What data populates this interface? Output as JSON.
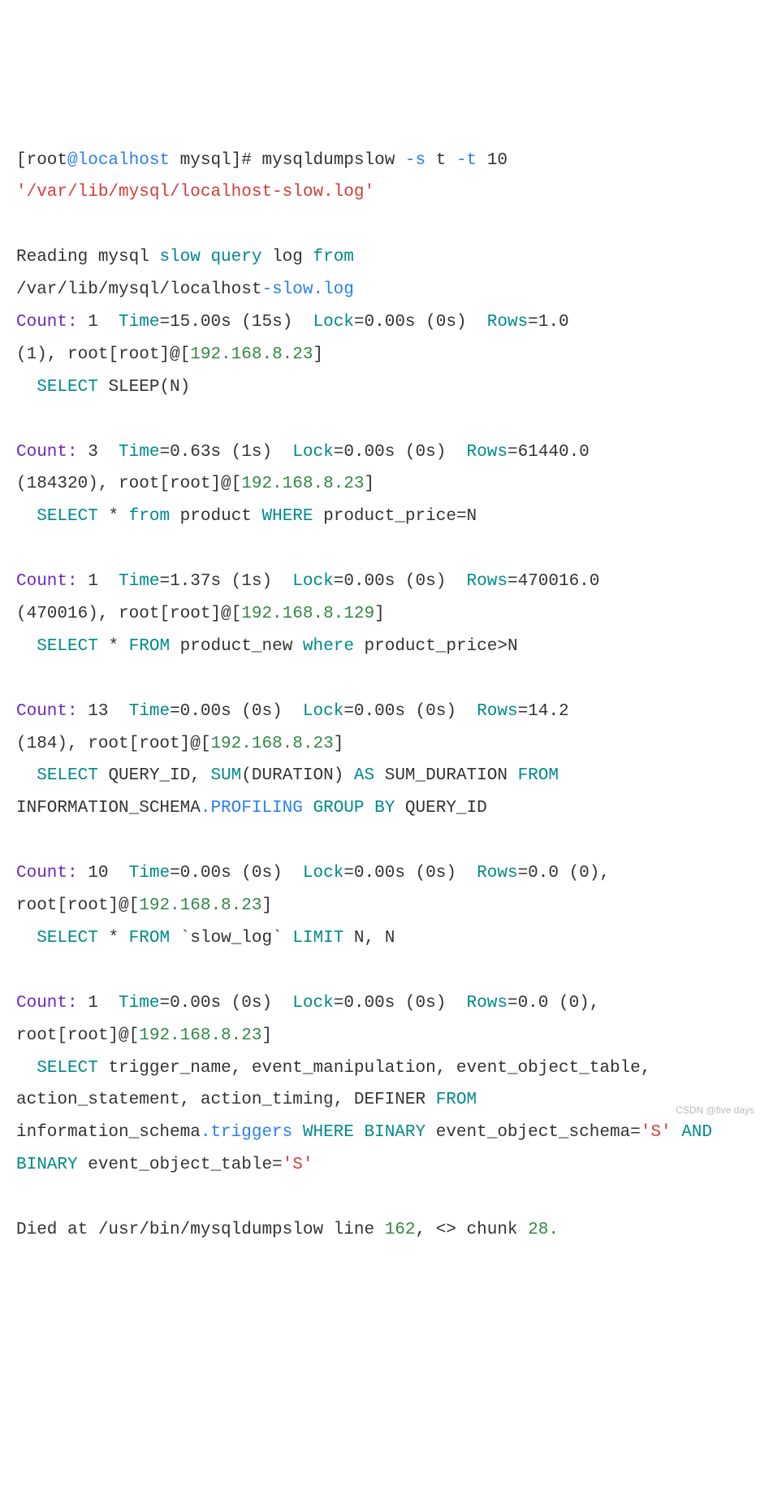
{
  "prompt": {
    "open": "[root",
    "at": "@localhost",
    "path": " mysql",
    "close": "]# "
  },
  "cmd": {
    "name": "mysqldumpslow ",
    "flag1": "-s",
    "arg1": " t ",
    "flag2": "-t",
    "arg2": " 10",
    "argpath": "'/var/lib/mysql/localhost-slow.log'"
  },
  "reading": {
    "l1a": "Reading mysql ",
    "l1b": "slow query",
    "l1c": " log ",
    "l1d": "from",
    "l2a": "/var/lib/mysql/localhost",
    "l2b": "-slow",
    "l2c": ".log"
  },
  "e1": {
    "count_lbl": "Count:",
    "count": " 1  ",
    "time_lbl": "Time",
    "time_val": "=15.00s (15s)  ",
    "lock_lbl": "Lock",
    "lock_val": "=0.00s (0s)  ",
    "rows_lbl": "Rows",
    "rows_val": "=1.0",
    "line2a": "(1), root[root]@[",
    "ip": "192.168.8.23",
    "line2b": "]",
    "sql_select": "SELECT",
    "sql_rest": " SLEEP(N)"
  },
  "e2": {
    "count_lbl": "Count:",
    "count": " 3  ",
    "time_lbl": "Time",
    "time_val": "=0.63s (1s)  ",
    "lock_lbl": "Lock",
    "lock_val": "=0.00s (0s)  ",
    "rows_lbl": "Rows",
    "rows_val": "=61440.0",
    "line2a": "(184320), root[root]@[",
    "ip": "192.168.8.23",
    "line2b": "]",
    "sql_select": "SELECT",
    "sql_mid1": " * ",
    "sql_from": "from",
    "sql_mid2": " product ",
    "sql_where": "WHERE",
    "sql_mid3": " product_price=N"
  },
  "e3": {
    "count_lbl": "Count:",
    "count": " 1  ",
    "time_lbl": "Time",
    "time_val": "=1.37s (1s)  ",
    "lock_lbl": "Lock",
    "lock_val": "=0.00s (0s)  ",
    "rows_lbl": "Rows",
    "rows_val": "=470016.0",
    "line2a": "(470016), root[root]@[",
    "ip": "192.168.8.129",
    "line2b": "]",
    "sql_select": "SELECT",
    "sql_mid1": " * ",
    "sql_from": "FROM",
    "sql_mid2": " product_new ",
    "sql_where": "where",
    "sql_mid3": " product_price>N"
  },
  "e4": {
    "count_lbl": "Count:",
    "count": " 13  ",
    "time_lbl": "Time",
    "time_val": "=0.00s (0s)  ",
    "lock_lbl": "Lock",
    "lock_val": "=0.00s (0s)  ",
    "rows_lbl": "Rows",
    "rows_val": "=14.2",
    "line2a": "(184), root[root]@[",
    "ip": "192.168.8.23",
    "line2b": "]",
    "sql_1": "SELECT",
    "sql_2": " QUERY_ID, ",
    "sql_3": "SUM",
    "sql_4": "(DURATION) ",
    "sql_5": "AS",
    "sql_6": " SUM_DURATION ",
    "sql_7": "FROM",
    "sql_8": "INFORMATION_SCHEMA",
    "sql_9": ".PROFILING",
    "sql_10": " ",
    "sql_11": "GROUP BY",
    "sql_12": " QUERY_ID"
  },
  "e5": {
    "count_lbl": "Count:",
    "count": " 10  ",
    "time_lbl": "Time",
    "time_val": "=0.00s (0s)  ",
    "lock_lbl": "Lock",
    "lock_val": "=0.00s (0s)  ",
    "rows_lbl": "Rows",
    "rows_val": "=0.0 (0),",
    "line2a": "root[root]@[",
    "ip": "192.168.8.23",
    "line2b": "]",
    "sql_1": "SELECT",
    "sql_2": " * ",
    "sql_3": "FROM",
    "sql_4": " `slow_log` ",
    "sql_5": "LIMIT",
    "sql_6": " N, N"
  },
  "e6": {
    "count_lbl": "Count:",
    "count": " 1  ",
    "time_lbl": "Time",
    "time_val": "=0.00s (0s)  ",
    "lock_lbl": "Lock",
    "lock_val": "=0.00s (0s)  ",
    "rows_lbl": "Rows",
    "rows_val": "=0.0 (0),",
    "line2a": "root[root]@[",
    "ip": "192.168.8.23",
    "line2b": "]",
    "sql_1": "SELECT",
    "sql_2": " trigger_name, event_manipulation, event_object_table, action_statement, action_timing, DEFINER ",
    "sql_3": "FROM",
    "sql_4": " information_schema",
    "sql_5": ".triggers",
    "sql_6": " ",
    "sql_7": "WHERE BINARY",
    "sql_8": " event_object_schema=",
    "sql_9": "'S'",
    "sql_10": " ",
    "sql_11": "AND BINARY",
    "sql_12": " event_object_table=",
    "sql_13": "'S'"
  },
  "died": {
    "a": "Died at /usr/bin/mysqldumpslow line ",
    "b": "162",
    "c": ", <> chunk ",
    "d": "28.",
    "e": ""
  },
  "footer": "CSDN @five days"
}
